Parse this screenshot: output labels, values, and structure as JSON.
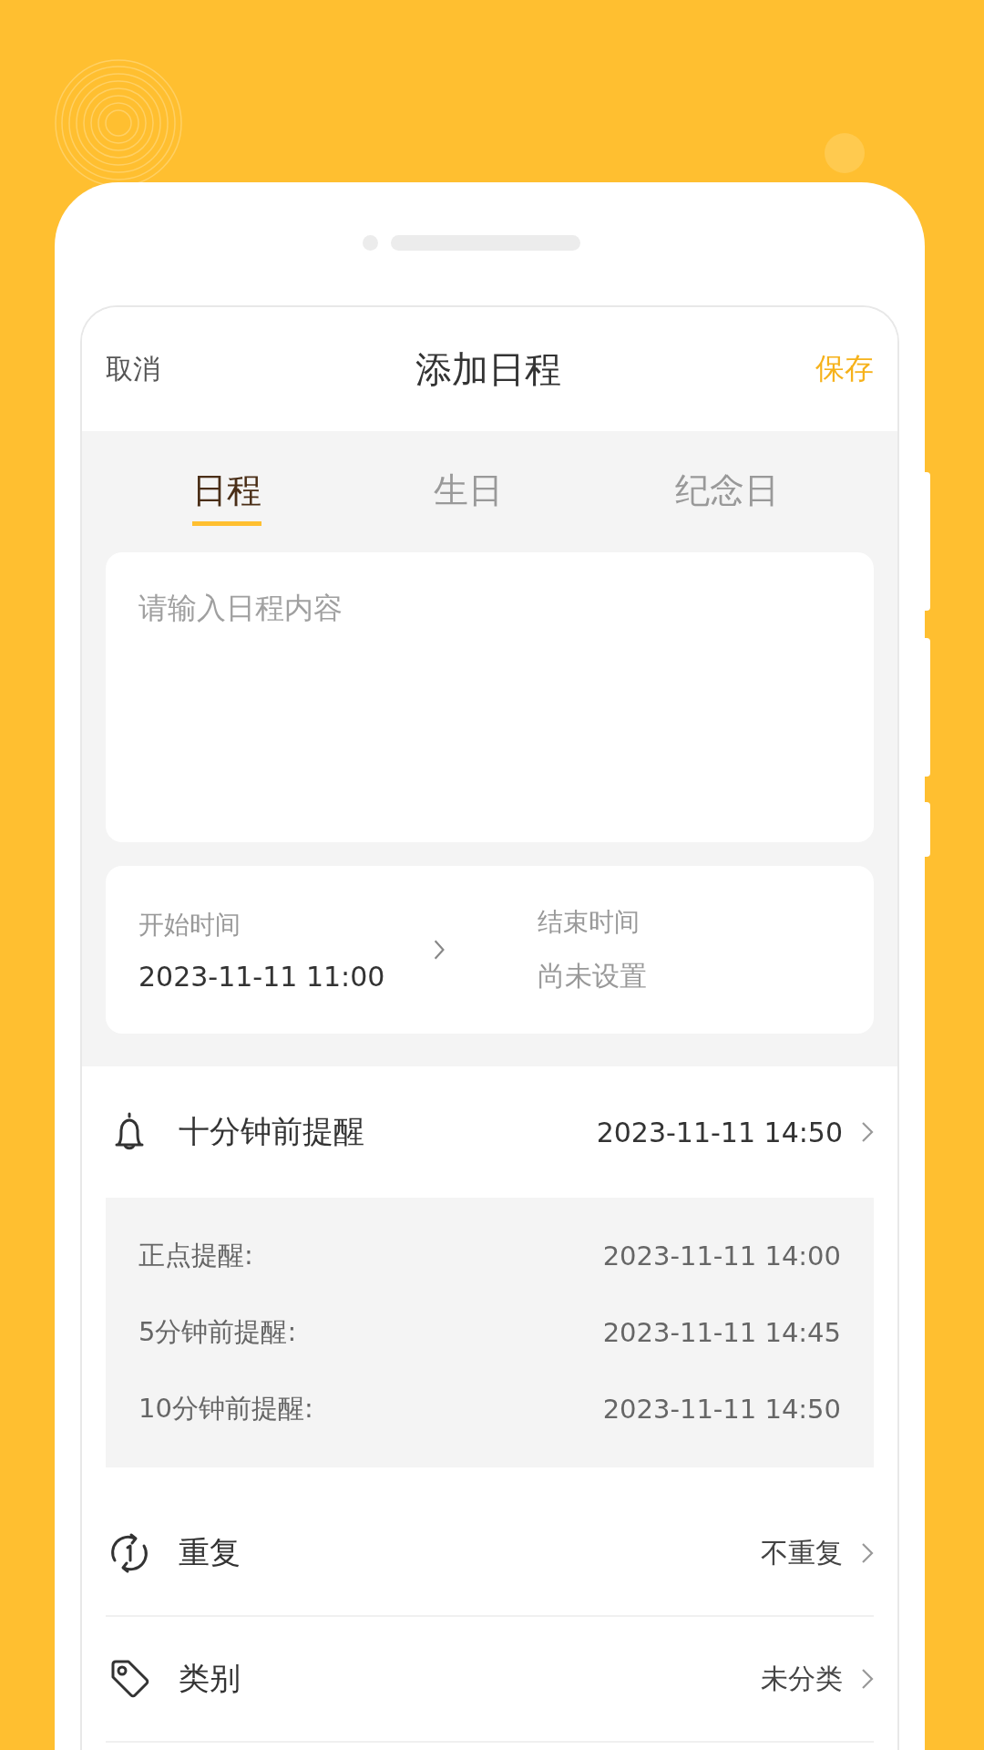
{
  "header": {
    "cancel": "取消",
    "title": "添加日程",
    "save": "保存"
  },
  "tabs": [
    {
      "label": "日程",
      "selected": true
    },
    {
      "label": "生日",
      "selected": false
    },
    {
      "label": "纪念日",
      "selected": false
    }
  ],
  "content": {
    "placeholder": "请输入日程内容"
  },
  "time": {
    "start_label": "开始时间",
    "start_value": "2023-11-11 11:00",
    "end_label": "结束时间",
    "end_value": "尚未设置"
  },
  "reminder": {
    "label": "十分钟前提醒",
    "value": "2023-11-11  14:50",
    "options": [
      {
        "label": "正点提醒:",
        "value": "2023-11-11  14:00"
      },
      {
        "label": "5分钟前提醒:",
        "value": "2023-11-11  14:45"
      },
      {
        "label": "10分钟前提醒:",
        "value": "2023-11-11  14:50"
      }
    ]
  },
  "settings": [
    {
      "kind": "repeat",
      "label": "重复",
      "value": "不重复"
    },
    {
      "kind": "category",
      "label": "类别",
      "value": "未分类"
    }
  ]
}
